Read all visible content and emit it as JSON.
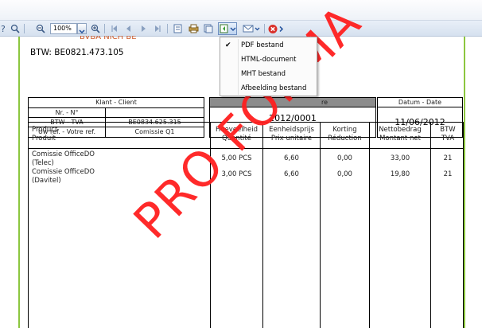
{
  "toolbar": {
    "zoom_value": "100%",
    "icons": [
      "help-icon",
      "zoom-out-icon",
      "zoom-in-icon",
      "first-page-icon",
      "prev-page-icon",
      "next-page-icon",
      "last-page-icon",
      "page-setup-icon",
      "print-icon",
      "copy-icon",
      "export-icon",
      "email-icon",
      "close-icon"
    ]
  },
  "document": {
    "cut_header": "BVBA NICH BE",
    "btw_line": "BTW: BE0821.473.105",
    "client": {
      "header": "Klant - Client",
      "rows": [
        {
          "label": "Nr. - N°",
          "value": ""
        },
        {
          "label": "BTW - TVA",
          "value": "BE0834.625.315"
        },
        {
          "label": "Uw ref. - Votre ref.",
          "value": "Comissie Q1"
        }
      ]
    },
    "invoice": {
      "header": "re",
      "number": "2012/0001",
      "date_header": "Datum - Date",
      "date": "11/06/2012"
    },
    "table": {
      "headers": [
        {
          "l1": "Product",
          "l2": "Produit"
        },
        {
          "l1": "Hoeveelheid",
          "l2": "Quantité"
        },
        {
          "l1": "Eenheidsprijs",
          "l2": "Prix unitaire"
        },
        {
          "l1": "Korting",
          "l2": "Réduction"
        },
        {
          "l1": "Nettobedrag",
          "l2": "Montant net"
        },
        {
          "l1": "BTW",
          "l2": "TVA"
        }
      ],
      "rows": [
        {
          "product_l1": "Comissie OfficeDO",
          "product_l2": "(Telec)",
          "qty": "5,00 PCS",
          "price": "6,60",
          "discount": "0,00",
          "net": "33,00",
          "vat": "21"
        },
        {
          "product_l1": "Comissie OfficeDO",
          "product_l2": "(Davitel)",
          "qty": "3,00 PCS",
          "price": "6,60",
          "discount": "0,00",
          "net": "19,80",
          "vat": "21"
        }
      ]
    },
    "watermark": "PRO FORMA"
  },
  "menu": {
    "items": [
      {
        "label": "PDF bestand",
        "checked": true
      },
      {
        "label": "HTML-document",
        "checked": false
      },
      {
        "label": "MHT bestand",
        "checked": false
      },
      {
        "label": "Afbeelding bestand",
        "checked": false
      }
    ],
    "check_glyph": "✔"
  },
  "colors": {
    "watermark": "#ff1f1f",
    "page_border": "#8cc63f",
    "header_fill": "#8c8c8c"
  }
}
